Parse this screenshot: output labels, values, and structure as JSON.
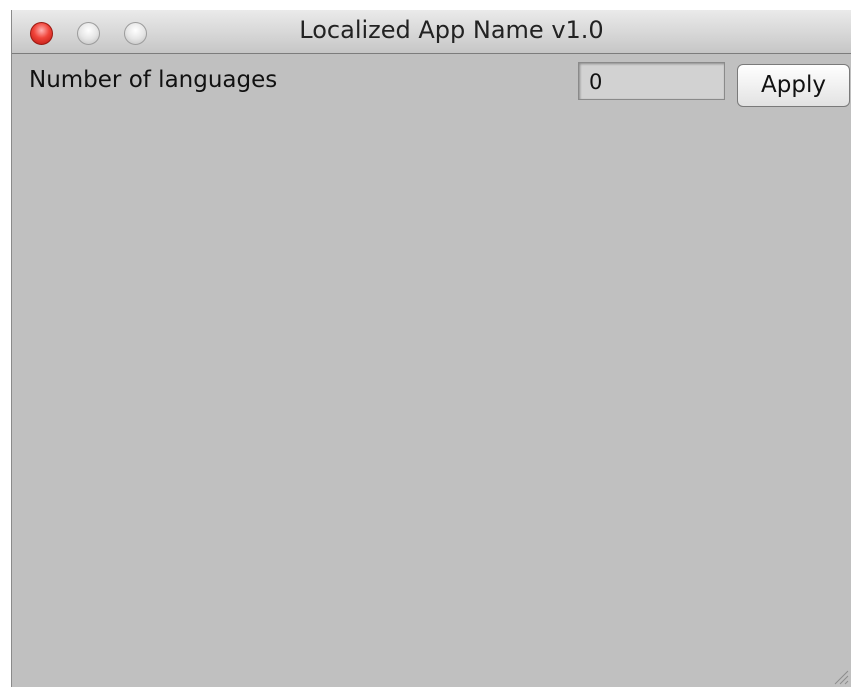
{
  "window": {
    "title": "Localized App Name v1.0"
  },
  "form": {
    "languages_label": "Number of languages",
    "languages_value": "0",
    "apply_label": "Apply"
  },
  "colors": {
    "window_background": "#c0c0c0",
    "close_button": "#f0443a"
  }
}
